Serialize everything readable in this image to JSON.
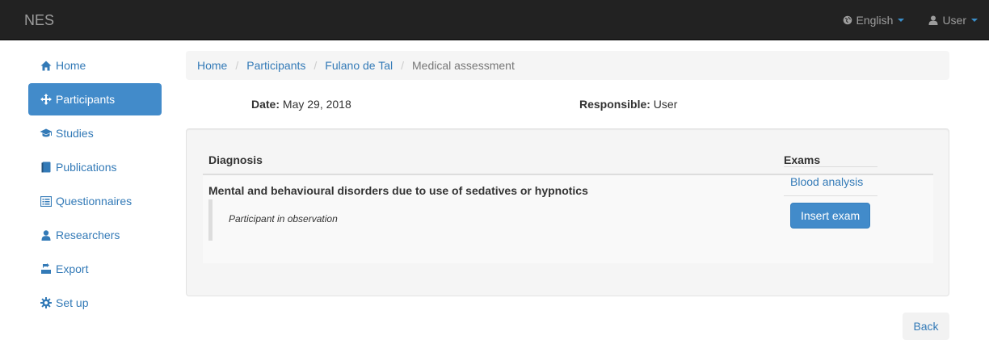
{
  "navbar": {
    "brand": "NES",
    "language": "English",
    "user": "User"
  },
  "sidebar": {
    "items": [
      {
        "label": "Home",
        "icon": "home-icon"
      },
      {
        "label": "Participants",
        "icon": "move-icon",
        "active": true
      },
      {
        "label": "Studies",
        "icon": "graduation-cap-icon"
      },
      {
        "label": "Publications",
        "icon": "book-icon"
      },
      {
        "label": "Questionnaires",
        "icon": "list-alt-icon"
      },
      {
        "label": "Researchers",
        "icon": "user-icon"
      },
      {
        "label": "Export",
        "icon": "export-icon"
      },
      {
        "label": "Set up",
        "icon": "cog-icon"
      }
    ]
  },
  "breadcrumb": {
    "items": [
      "Home",
      "Participants",
      "Fulano de Tal"
    ],
    "current": "Medical assessment",
    "separator": "/"
  },
  "info": {
    "date_label": "Date:",
    "date_value": "May 29, 2018",
    "responsible_label": "Responsible:",
    "responsible_value": "User"
  },
  "table": {
    "headers": {
      "diagnosis": "Diagnosis",
      "exams": "Exams"
    },
    "row": {
      "diagnosis": "Mental and behavioural disorders due to use of sedatives or hypnotics",
      "note": "Participant in observation",
      "exam_link": "Blood analysis",
      "insert_exam": "Insert exam"
    }
  },
  "back_button": "Back",
  "colors": {
    "navbar_bg": "#222222",
    "accent": "#428bca",
    "link": "#337ab7"
  }
}
